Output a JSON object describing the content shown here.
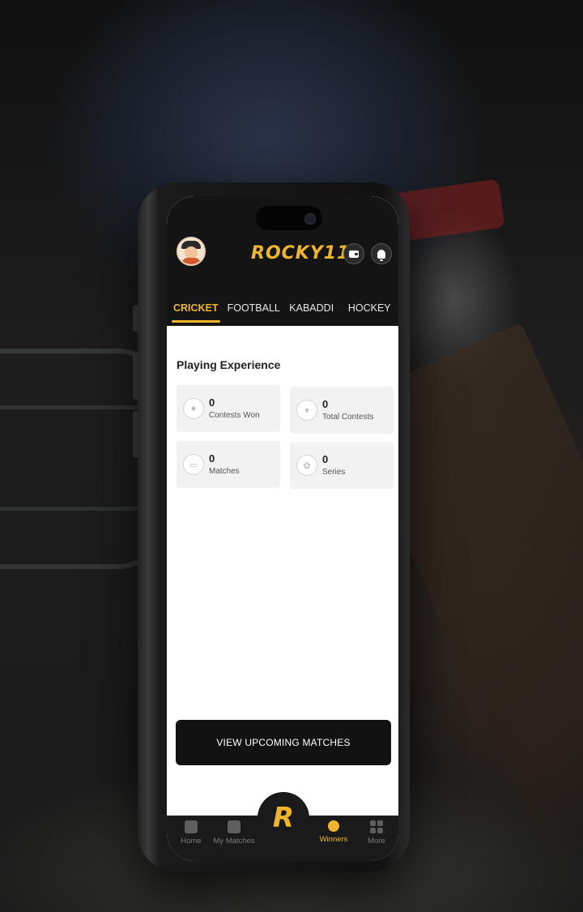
{
  "header": {
    "logo_text": "ROCKY11",
    "wallet_icon": "wallet-icon",
    "bell_icon": "bell-icon",
    "accent": "#f0b52a"
  },
  "tabs": [
    {
      "label": "CRICKET",
      "active": true
    },
    {
      "label": "FOOTBALL",
      "active": false
    },
    {
      "label": "KABADDI",
      "active": false
    },
    {
      "label": "HOCKEY",
      "active": false
    }
  ],
  "main": {
    "section_title": "Playing Experience",
    "stats": [
      {
        "value": "0",
        "label": "Contests Won",
        "icon": "medal-icon"
      },
      {
        "value": "0",
        "label": "Total Contests",
        "icon": "trophy-icon"
      },
      {
        "value": "0",
        "label": "Matches",
        "icon": "match-icon"
      },
      {
        "value": "0",
        "label": "Series",
        "icon": "laurel-icon"
      }
    ],
    "cta_label": "VIEW UPCOMING MATCHES"
  },
  "bottom_nav": [
    {
      "label": "Home",
      "icon": "home-icon"
    },
    {
      "label": "My Matches",
      "icon": "trophy-icon"
    },
    {
      "label": "Winners",
      "icon": "medal-icon",
      "active": true
    },
    {
      "label": "More",
      "icon": "grid-icon"
    }
  ]
}
